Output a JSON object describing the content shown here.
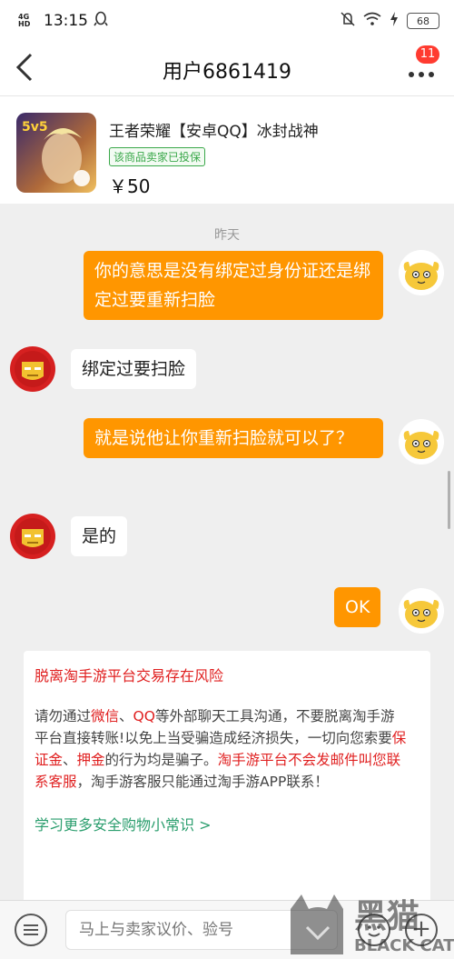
{
  "status_bar": {
    "network": "4G HD",
    "time": "13:15",
    "battery": "68"
  },
  "nav": {
    "title": "用户6861419",
    "badge": "11"
  },
  "product": {
    "title": "王者荣耀【安卓QQ】冰封战神",
    "tag": "该商品卖家已投保",
    "price": "￥50",
    "image_text": "5v5"
  },
  "chat": {
    "timestamp": "昨天",
    "messages": [
      {
        "from": "me",
        "text": "你的意思是没有绑定过身份证还是绑定过要重新扫脸"
      },
      {
        "from": "seller",
        "text": "绑定过要扫脸"
      },
      {
        "from": "me",
        "text": "就是说他让你重新扫脸就可以了？"
      },
      {
        "from": "seller",
        "text": "是的"
      },
      {
        "from": "me",
        "text": "OK"
      }
    ]
  },
  "warning": {
    "title": "脱离淘手游平台交易存在风险",
    "p1": "请勿通过",
    "r1": "微信",
    "p2": "、",
    "r2": "QQ",
    "p3": "等外部聊天工具沟通，不要脱离淘手游平台直接转账!以免上当受骗造成经济损失，一切向您索要",
    "r3": "保证金",
    "p4": "、",
    "r4": "押金",
    "p5": "的行为均是骗子。",
    "r5": "淘手游平台不会发邮件叫您联系客服",
    "p6": "，淘手游客服只能通过淘手游APP联系！",
    "link": "学习更多安全购物小常识 >"
  },
  "input": {
    "placeholder": "马上与卖家议价、验号"
  },
  "watermark": {
    "text": "黑猫",
    "subtext": "BLACK CAT"
  },
  "colors": {
    "accent": "#ff9600",
    "warning_red": "#e02020",
    "link_green": "#2b9e6e"
  }
}
